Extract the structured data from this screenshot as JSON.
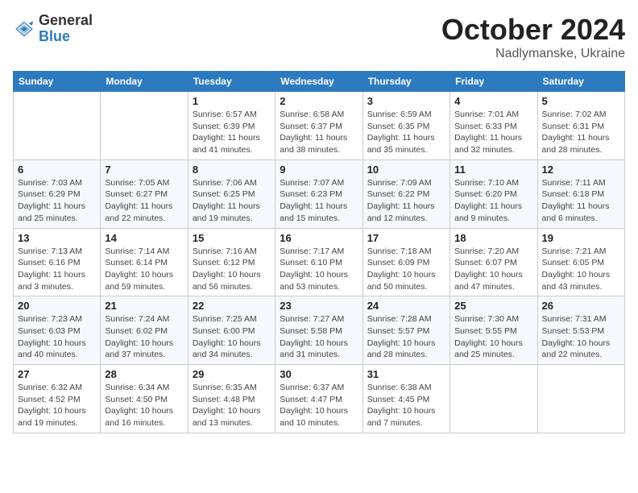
{
  "logo": {
    "general": "General",
    "blue": "Blue"
  },
  "title": {
    "month": "October 2024",
    "location": "Nadlymanske, Ukraine"
  },
  "header": {
    "days": [
      "Sunday",
      "Monday",
      "Tuesday",
      "Wednesday",
      "Thursday",
      "Friday",
      "Saturday"
    ]
  },
  "weeks": [
    [
      {
        "day": "",
        "info": ""
      },
      {
        "day": "",
        "info": ""
      },
      {
        "day": "1",
        "info": "Sunrise: 6:57 AM\nSunset: 6:39 PM\nDaylight: 11 hours and 41 minutes."
      },
      {
        "day": "2",
        "info": "Sunrise: 6:58 AM\nSunset: 6:37 PM\nDaylight: 11 hours and 38 minutes."
      },
      {
        "day": "3",
        "info": "Sunrise: 6:59 AM\nSunset: 6:35 PM\nDaylight: 11 hours and 35 minutes."
      },
      {
        "day": "4",
        "info": "Sunrise: 7:01 AM\nSunset: 6:33 PM\nDaylight: 11 hours and 32 minutes."
      },
      {
        "day": "5",
        "info": "Sunrise: 7:02 AM\nSunset: 6:31 PM\nDaylight: 11 hours and 28 minutes."
      }
    ],
    [
      {
        "day": "6",
        "info": "Sunrise: 7:03 AM\nSunset: 6:29 PM\nDaylight: 11 hours and 25 minutes."
      },
      {
        "day": "7",
        "info": "Sunrise: 7:05 AM\nSunset: 6:27 PM\nDaylight: 11 hours and 22 minutes."
      },
      {
        "day": "8",
        "info": "Sunrise: 7:06 AM\nSunset: 6:25 PM\nDaylight: 11 hours and 19 minutes."
      },
      {
        "day": "9",
        "info": "Sunrise: 7:07 AM\nSunset: 6:23 PM\nDaylight: 11 hours and 15 minutes."
      },
      {
        "day": "10",
        "info": "Sunrise: 7:09 AM\nSunset: 6:22 PM\nDaylight: 11 hours and 12 minutes."
      },
      {
        "day": "11",
        "info": "Sunrise: 7:10 AM\nSunset: 6:20 PM\nDaylight: 11 hours and 9 minutes."
      },
      {
        "day": "12",
        "info": "Sunrise: 7:11 AM\nSunset: 6:18 PM\nDaylight: 11 hours and 6 minutes."
      }
    ],
    [
      {
        "day": "13",
        "info": "Sunrise: 7:13 AM\nSunset: 6:16 PM\nDaylight: 11 hours and 3 minutes."
      },
      {
        "day": "14",
        "info": "Sunrise: 7:14 AM\nSunset: 6:14 PM\nDaylight: 10 hours and 59 minutes."
      },
      {
        "day": "15",
        "info": "Sunrise: 7:16 AM\nSunset: 6:12 PM\nDaylight: 10 hours and 56 minutes."
      },
      {
        "day": "16",
        "info": "Sunrise: 7:17 AM\nSunset: 6:10 PM\nDaylight: 10 hours and 53 minutes."
      },
      {
        "day": "17",
        "info": "Sunrise: 7:18 AM\nSunset: 6:09 PM\nDaylight: 10 hours and 50 minutes."
      },
      {
        "day": "18",
        "info": "Sunrise: 7:20 AM\nSunset: 6:07 PM\nDaylight: 10 hours and 47 minutes."
      },
      {
        "day": "19",
        "info": "Sunrise: 7:21 AM\nSunset: 6:05 PM\nDaylight: 10 hours and 43 minutes."
      }
    ],
    [
      {
        "day": "20",
        "info": "Sunrise: 7:23 AM\nSunset: 6:03 PM\nDaylight: 10 hours and 40 minutes."
      },
      {
        "day": "21",
        "info": "Sunrise: 7:24 AM\nSunset: 6:02 PM\nDaylight: 10 hours and 37 minutes."
      },
      {
        "day": "22",
        "info": "Sunrise: 7:25 AM\nSunset: 6:00 PM\nDaylight: 10 hours and 34 minutes."
      },
      {
        "day": "23",
        "info": "Sunrise: 7:27 AM\nSunset: 5:58 PM\nDaylight: 10 hours and 31 minutes."
      },
      {
        "day": "24",
        "info": "Sunrise: 7:28 AM\nSunset: 5:57 PM\nDaylight: 10 hours and 28 minutes."
      },
      {
        "day": "25",
        "info": "Sunrise: 7:30 AM\nSunset: 5:55 PM\nDaylight: 10 hours and 25 minutes."
      },
      {
        "day": "26",
        "info": "Sunrise: 7:31 AM\nSunset: 5:53 PM\nDaylight: 10 hours and 22 minutes."
      }
    ],
    [
      {
        "day": "27",
        "info": "Sunrise: 6:32 AM\nSunset: 4:52 PM\nDaylight: 10 hours and 19 minutes."
      },
      {
        "day": "28",
        "info": "Sunrise: 6:34 AM\nSunset: 4:50 PM\nDaylight: 10 hours and 16 minutes."
      },
      {
        "day": "29",
        "info": "Sunrise: 6:35 AM\nSunset: 4:48 PM\nDaylight: 10 hours and 13 minutes."
      },
      {
        "day": "30",
        "info": "Sunrise: 6:37 AM\nSunset: 4:47 PM\nDaylight: 10 hours and 10 minutes."
      },
      {
        "day": "31",
        "info": "Sunrise: 6:38 AM\nSunset: 4:45 PM\nDaylight: 10 hours and 7 minutes."
      },
      {
        "day": "",
        "info": ""
      },
      {
        "day": "",
        "info": ""
      }
    ]
  ]
}
